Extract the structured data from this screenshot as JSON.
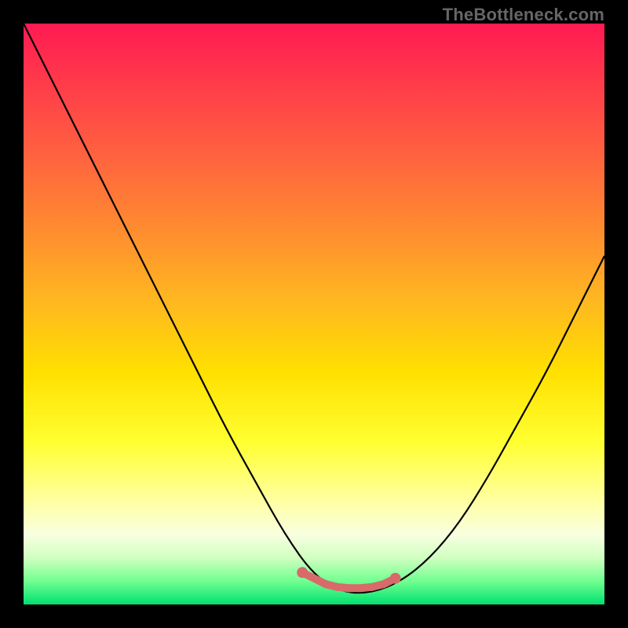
{
  "watermark": "TheBottleneck.com",
  "chart_data": {
    "type": "line",
    "title": "",
    "xlabel": "",
    "ylabel": "",
    "xlim": [
      0,
      1
    ],
    "ylim": [
      0,
      1
    ],
    "grid": false,
    "series": [
      {
        "name": "curve",
        "color": "#000000",
        "x": [
          0.0,
          0.05,
          0.1,
          0.15,
          0.2,
          0.25,
          0.3,
          0.35,
          0.4,
          0.45,
          0.5,
          0.55,
          0.6,
          0.65,
          0.7,
          0.75,
          0.8,
          0.85,
          0.9,
          0.95,
          1.0
        ],
        "y": [
          1.0,
          0.9,
          0.8,
          0.7,
          0.6,
          0.5,
          0.4,
          0.3,
          0.21,
          0.12,
          0.05,
          0.02,
          0.02,
          0.04,
          0.08,
          0.14,
          0.22,
          0.31,
          0.4,
          0.5,
          0.6
        ]
      },
      {
        "name": "highlight",
        "color": "#d86a6a",
        "points": [
          {
            "x": 0.48,
            "y": 0.055
          },
          {
            "x": 0.5,
            "y": 0.045
          },
          {
            "x": 0.52,
            "y": 0.035
          },
          {
            "x": 0.54,
            "y": 0.03
          },
          {
            "x": 0.56,
            "y": 0.028
          },
          {
            "x": 0.58,
            "y": 0.028
          },
          {
            "x": 0.6,
            "y": 0.03
          },
          {
            "x": 0.62,
            "y": 0.035
          },
          {
            "x": 0.64,
            "y": 0.045
          }
        ]
      }
    ],
    "background_gradient": {
      "top": "#ff1a52",
      "bottom": "#00e070"
    }
  }
}
